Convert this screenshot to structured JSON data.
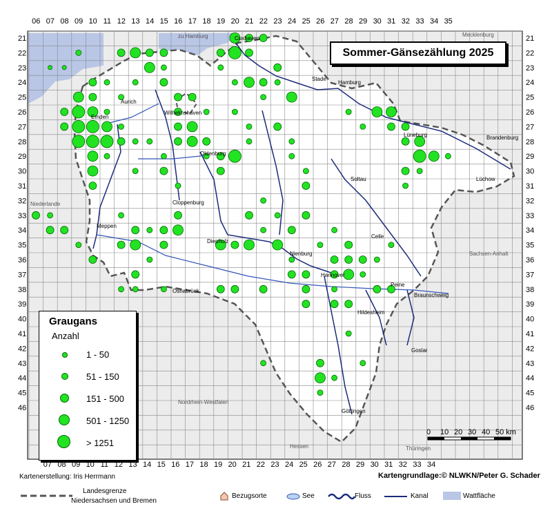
{
  "title": "Sommer-Gänsezählung 2025",
  "legend": {
    "species": "Graugans",
    "subtitle": "Anzahl",
    "classes": [
      "1 - 50",
      "51 - 150",
      "151 - 500",
      "501 - 1250",
      "> 1251"
    ]
  },
  "grid": {
    "top_columns": [
      "06",
      "07",
      "08",
      "09",
      "10",
      "11",
      "12",
      "13",
      "14",
      "15",
      "16",
      "17",
      "18",
      "19",
      "20",
      "21",
      "22",
      "23",
      "24",
      "25",
      "26",
      "27",
      "28",
      "29",
      "30",
      "31",
      "32",
      "33",
      "34",
      "35"
    ],
    "bottom_columns": [
      "07",
      "08",
      "09",
      "10",
      "11",
      "12",
      "13",
      "14",
      "15",
      "16",
      "17",
      "18",
      "19",
      "20",
      "21",
      "22",
      "23",
      "24",
      "25",
      "26",
      "27",
      "28",
      "29",
      "30",
      "31",
      "32",
      "33",
      "34"
    ],
    "rows": [
      "21",
      "22",
      "23",
      "24",
      "25",
      "26",
      "27",
      "28",
      "29",
      "30",
      "31",
      "32",
      "33",
      "34",
      "35",
      "36",
      "37",
      "38",
      "39",
      "40",
      "41",
      "42",
      "43",
      "44",
      "45",
      "46"
    ]
  },
  "places": [
    "Cuxhaven",
    "Stade",
    "Hamburg",
    "Aurich",
    "Emden",
    "Wilhelmshaven",
    "Oldenburg",
    "Lüneburg",
    "Brandenburg",
    "Lüchow",
    "Soltau",
    "Cloppenburg",
    "Meppen",
    "Diepholz",
    "Nienburg",
    "Celle",
    "Hannover",
    "Peine",
    "Braunschweig",
    "Hildesheim",
    "Osnabrück",
    "Goslar",
    "Göttingen"
  ],
  "regions": [
    "Niederlande",
    "Sachsen-Anhalt",
    "Nordrhein-Westfalen",
    "Hessen",
    "Thüringen",
    "Mecklenburg",
    "zu Hamburg"
  ],
  "scale": {
    "ticks": [
      "0",
      "10",
      "20",
      "30",
      "40",
      "50 km"
    ]
  },
  "credits": {
    "left": "Kartenerstellung: Iris Herrmann",
    "right": "Kartengrundlage:© NLWKN/Peter G. Schader"
  },
  "bottom_legend": {
    "border_line1": "Landesgrenze",
    "border_line2": "Niedersachsen und Bremen",
    "ref": "Bezugsorte",
    "lake": "See",
    "river": "Fluss",
    "canal": "Kanal",
    "mudflat": "Wattfläche"
  },
  "colors": {
    "dot": "#22e322",
    "dot_stroke": "#006600",
    "water": "#3355bb",
    "mudflat": "#b9c6e6"
  },
  "observations": [
    {
      "col": "06",
      "row": "33",
      "cls": 3
    },
    {
      "col": "07",
      "row": "33",
      "cls": 2
    },
    {
      "col": "08",
      "row": "34",
      "cls": 3
    },
    {
      "col": "07",
      "row": "34",
      "cls": 3
    },
    {
      "col": "09",
      "row": "35",
      "cls": 2
    },
    {
      "col": "10",
      "row": "36",
      "cls": 3
    },
    {
      "col": "09",
      "row": "22",
      "cls": 2
    },
    {
      "col": "08",
      "row": "23",
      "cls": 1
    },
    {
      "col": "07",
      "row": "23",
      "cls": 1
    },
    {
      "col": "09",
      "row": "25",
      "cls": 4
    },
    {
      "col": "10",
      "row": "25",
      "cls": 3
    },
    {
      "col": "09",
      "row": "26",
      "cls": 5
    },
    {
      "col": "10",
      "row": "26",
      "cls": 4
    },
    {
      "col": "08",
      "row": "26",
      "cls": 3
    },
    {
      "col": "08",
      "row": "27",
      "cls": 3
    },
    {
      "col": "09",
      "row": "27",
      "cls": 5
    },
    {
      "col": "10",
      "row": "27",
      "cls": 5
    },
    {
      "col": "11",
      "row": "27",
      "cls": 4
    },
    {
      "col": "09",
      "row": "28",
      "cls": 5
    },
    {
      "col": "10",
      "row": "28",
      "cls": 5
    },
    {
      "col": "11",
      "row": "28",
      "cls": 5
    },
    {
      "col": "12",
      "row": "28",
      "cls": 3
    },
    {
      "col": "10",
      "row": "29",
      "cls": 4
    },
    {
      "col": "11",
      "row": "29",
      "cls": 2
    },
    {
      "col": "12",
      "row": "27",
      "cls": 2
    },
    {
      "col": "11",
      "row": "26",
      "cls": 2
    },
    {
      "col": "12",
      "row": "25",
      "cls": 2
    },
    {
      "col": "11",
      "row": "24",
      "cls": 2
    },
    {
      "col": "10",
      "row": "24",
      "cls": 3
    },
    {
      "col": "10",
      "row": "30",
      "cls": 4
    },
    {
      "col": "10",
      "row": "31",
      "cls": 3
    },
    {
      "col": "13",
      "row": "28",
      "cls": 2
    },
    {
      "col": "14",
      "row": "28",
      "cls": 2
    },
    {
      "col": "12",
      "row": "22",
      "cls": 3
    },
    {
      "col": "13",
      "row": "22",
      "cls": 4
    },
    {
      "col": "14",
      "row": "22",
      "cls": 3
    },
    {
      "col": "15",
      "row": "22",
      "cls": 3
    },
    {
      "col": "14",
      "row": "23",
      "cls": 4
    },
    {
      "col": "15",
      "row": "23",
      "cls": 2
    },
    {
      "col": "13",
      "row": "24",
      "cls": 2
    },
    {
      "col": "15",
      "row": "24",
      "cls": 3
    },
    {
      "col": "16",
      "row": "25",
      "cls": 3
    },
    {
      "col": "17",
      "row": "25",
      "cls": 3
    },
    {
      "col": "16",
      "row": "26",
      "cls": 3
    },
    {
      "col": "17",
      "row": "27",
      "cls": 4
    },
    {
      "col": "16",
      "row": "27",
      "cls": 3
    },
    {
      "col": "17",
      "row": "28",
      "cls": 4
    },
    {
      "col": "16",
      "row": "28",
      "cls": 3
    },
    {
      "col": "18",
      "row": "26",
      "cls": 2
    },
    {
      "col": "15",
      "row": "29",
      "cls": 2
    },
    {
      "col": "15",
      "row": "30",
      "cls": 3
    },
    {
      "col": "13",
      "row": "30",
      "cls": 2
    },
    {
      "col": "16",
      "row": "31",
      "cls": 2
    },
    {
      "col": "20",
      "row": "21",
      "cls": 4
    },
    {
      "col": "21",
      "row": "21",
      "cls": 3
    },
    {
      "col": "22",
      "row": "21",
      "cls": 3
    },
    {
      "col": "19",
      "row": "22",
      "cls": 3
    },
    {
      "col": "20",
      "row": "22",
      "cls": 5
    },
    {
      "col": "21",
      "row": "22",
      "cls": 3
    },
    {
      "col": "19",
      "row": "23",
      "cls": 2
    },
    {
      "col": "21",
      "row": "24",
      "cls": 4
    },
    {
      "col": "22",
      "row": "24",
      "cls": 3
    },
    {
      "col": "20",
      "row": "24",
      "cls": 2
    },
    {
      "col": "23",
      "row": "23",
      "cls": 3
    },
    {
      "col": "24",
      "row": "25",
      "cls": 4
    },
    {
      "col": "23",
      "row": "24",
      "cls": 2
    },
    {
      "col": "22",
      "row": "25",
      "cls": 2
    },
    {
      "col": "18",
      "row": "28",
      "cls": 3
    },
    {
      "col": "19",
      "row": "29",
      "cls": 3
    },
    {
      "col": "20",
      "row": "29",
      "cls": 5
    },
    {
      "col": "19",
      "row": "30",
      "cls": 3
    },
    {
      "col": "21",
      "row": "28",
      "cls": 2
    },
    {
      "col": "18",
      "row": "29",
      "cls": 2
    },
    {
      "col": "20",
      "row": "26",
      "cls": 2
    },
    {
      "col": "21",
      "row": "27",
      "cls": 2
    },
    {
      "col": "23",
      "row": "27",
      "cls": 3
    },
    {
      "col": "24",
      "row": "28",
      "cls": 2
    },
    {
      "col": "24",
      "row": "29",
      "cls": 2
    },
    {
      "col": "25",
      "row": "30",
      "cls": 2
    },
    {
      "col": "25",
      "row": "31",
      "cls": 3
    },
    {
      "col": "30",
      "row": "26",
      "cls": 4
    },
    {
      "col": "31",
      "row": "26",
      "cls": 4
    },
    {
      "col": "32",
      "row": "27",
      "cls": 3
    },
    {
      "col": "33",
      "row": "28",
      "cls": 4
    },
    {
      "col": "33",
      "row": "29",
      "cls": 5
    },
    {
      "col": "34",
      "row": "29",
      "cls": 4
    },
    {
      "col": "35",
      "row": "29",
      "cls": 2
    },
    {
      "col": "32",
      "row": "28",
      "cls": 3
    },
    {
      "col": "31",
      "row": "27",
      "cls": 3
    },
    {
      "col": "29",
      "row": "27",
      "cls": 2
    },
    {
      "col": "28",
      "row": "26",
      "cls": 2
    },
    {
      "col": "32",
      "row": "30",
      "cls": 3
    },
    {
      "col": "33",
      "row": "30",
      "cls": 2
    },
    {
      "col": "32",
      "row": "31",
      "cls": 2
    },
    {
      "col": "21",
      "row": "33",
      "cls": 3
    },
    {
      "col": "22",
      "row": "32",
      "cls": 2
    },
    {
      "col": "23",
      "row": "33",
      "cls": 2
    },
    {
      "col": "25",
      "row": "33",
      "cls": 3
    },
    {
      "col": "24",
      "row": "34",
      "cls": 3
    },
    {
      "col": "22",
      "row": "34",
      "cls": 2
    },
    {
      "col": "21",
      "row": "35",
      "cls": 4
    },
    {
      "col": "20",
      "row": "35",
      "cls": 3
    },
    {
      "col": "19",
      "row": "35",
      "cls": 4
    },
    {
      "col": "23",
      "row": "35",
      "cls": 4
    },
    {
      "col": "24",
      "row": "36",
      "cls": 2
    },
    {
      "col": "26",
      "row": "35",
      "cls": 2
    },
    {
      "col": "27",
      "row": "34",
      "cls": 2
    },
    {
      "col": "28",
      "row": "35",
      "cls": 3
    },
    {
      "col": "27",
      "row": "36",
      "cls": 3
    },
    {
      "col": "28",
      "row": "36",
      "cls": 3
    },
    {
      "col": "29",
      "row": "36",
      "cls": 3
    },
    {
      "col": "28",
      "row": "37",
      "cls": 4
    },
    {
      "col": "29",
      "row": "37",
      "cls": 2
    },
    {
      "col": "30",
      "row": "36",
      "cls": 2
    },
    {
      "col": "31",
      "row": "35",
      "cls": 2
    },
    {
      "col": "30",
      "row": "38",
      "cls": 3
    },
    {
      "col": "31",
      "row": "38",
      "cls": 3
    },
    {
      "col": "24",
      "row": "37",
      "cls": 3
    },
    {
      "col": "25",
      "row": "37",
      "cls": 3
    },
    {
      "col": "25",
      "row": "38",
      "cls": 3
    },
    {
      "col": "25",
      "row": "39",
      "cls": 3
    },
    {
      "col": "27",
      "row": "37",
      "cls": 3
    },
    {
      "col": "27",
      "row": "38",
      "cls": 2
    },
    {
      "col": "27",
      "row": "39",
      "cls": 3
    },
    {
      "col": "28",
      "row": "39",
      "cls": 3
    },
    {
      "col": "22",
      "row": "38",
      "cls": 3
    },
    {
      "col": "20",
      "row": "38",
      "cls": 3
    },
    {
      "col": "19",
      "row": "38",
      "cls": 3
    },
    {
      "col": "12",
      "row": "33",
      "cls": 2
    },
    {
      "col": "13",
      "row": "34",
      "cls": 3
    },
    {
      "col": "13",
      "row": "35",
      "cls": 4
    },
    {
      "col": "12",
      "row": "35",
      "cls": 3
    },
    {
      "col": "14",
      "row": "34",
      "cls": 2
    },
    {
      "col": "15",
      "row": "35",
      "cls": 3
    },
    {
      "col": "15",
      "row": "34",
      "cls": 3
    },
    {
      "col": "16",
      "row": "34",
      "cls": 4
    },
    {
      "col": "16",
      "row": "33",
      "cls": 3
    },
    {
      "col": "14",
      "row": "36",
      "cls": 2
    },
    {
      "col": "13",
      "row": "37",
      "cls": 3
    },
    {
      "col": "15",
      "row": "38",
      "cls": 2
    },
    {
      "col": "13",
      "row": "38",
      "cls": 2
    },
    {
      "col": "12",
      "row": "38",
      "cls": 2
    },
    {
      "col": "26",
      "row": "43",
      "cls": 3
    },
    {
      "col": "27",
      "row": "44",
      "cls": 2
    },
    {
      "col": "26",
      "row": "44",
      "cls": 4
    },
    {
      "col": "26",
      "row": "45",
      "cls": 2
    },
    {
      "col": "22",
      "row": "43",
      "cls": 2
    },
    {
      "col": "29",
      "row": "43",
      "cls": 2
    },
    {
      "col": "28",
      "row": "41",
      "cls": 2
    }
  ]
}
